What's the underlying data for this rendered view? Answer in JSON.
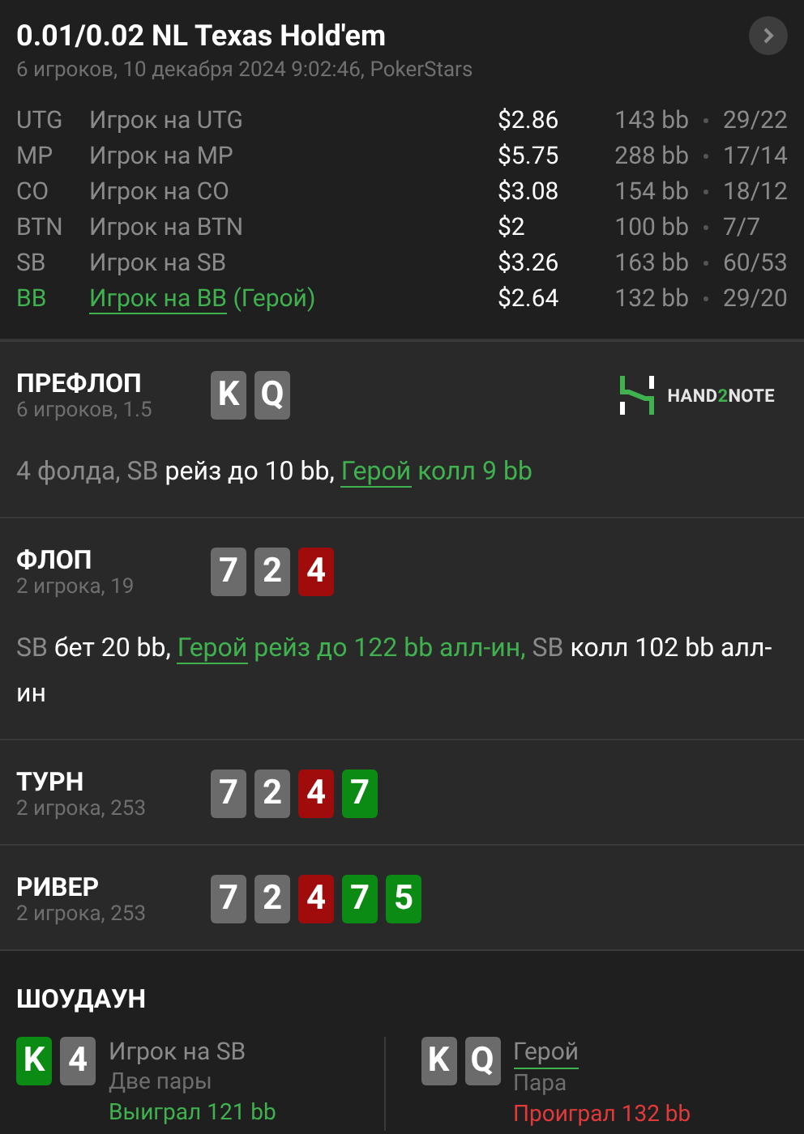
{
  "header": {
    "title": "0.01/0.02 NL Texas Hold'em",
    "subtitle": "6 игроков, 10 декабря 2024 9:02:46, PokerStars"
  },
  "players": [
    {
      "position": "UTG",
      "name": "Игрок на UTG",
      "hero": false,
      "stack": "$2.86",
      "bb": "143 bb",
      "stats": "29/22"
    },
    {
      "position": "MP",
      "name": "Игрок на MP",
      "hero": false,
      "stack": "$5.75",
      "bb": "288 bb",
      "stats": "17/14"
    },
    {
      "position": "CO",
      "name": "Игрок на CO",
      "hero": false,
      "stack": "$3.08",
      "bb": "154 bb",
      "stats": "18/12"
    },
    {
      "position": "BTN",
      "name": "Игрок на BTN",
      "hero": false,
      "stack": "$2",
      "bb": "100 bb",
      "stats": "7/7"
    },
    {
      "position": "SB",
      "name": "Игрок на SB",
      "hero": false,
      "stack": "$3.26",
      "bb": "163 bb",
      "stats": "60/53"
    },
    {
      "position": "BB",
      "name": "Игрок на BB",
      "hero_label": "(Герой)",
      "hero": true,
      "stack": "$2.64",
      "bb": "132 bb",
      "stats": "29/20"
    }
  ],
  "logo": {
    "start": "HAND",
    "mid": "2",
    "end": "NOTE"
  },
  "streets": [
    {
      "name": "ПРЕФЛОП",
      "info": "6 игроков, 1.5",
      "cards": [
        {
          "rank": "K",
          "color": "#6b6b6b"
        },
        {
          "rank": "Q",
          "color": "#6b6b6b"
        }
      ],
      "actions": [
        {
          "kind": "player",
          "text": "4 фолда, SB"
        },
        {
          "kind": "action",
          "text": "рейз до 10 bb,"
        },
        {
          "kind": "hero",
          "text": "Герой"
        },
        {
          "kind": "hero_action",
          "text": "колл 9 bb"
        }
      ]
    },
    {
      "name": "ФЛОП",
      "info": "2 игрока, 19",
      "cards": [
        {
          "rank": "7",
          "color": "#6b6b6b"
        },
        {
          "rank": "2",
          "color": "#6b6b6b"
        },
        {
          "rank": "4",
          "color": "#a00c0c"
        }
      ],
      "actions": [
        {
          "kind": "player",
          "text": "SB"
        },
        {
          "kind": "action",
          "text": "бет 20 bb,"
        },
        {
          "kind": "hero",
          "text": "Герой"
        },
        {
          "kind": "hero_action",
          "text": "рейз до 122 bb алл-ин,"
        },
        {
          "kind": "player",
          "text": "SB"
        },
        {
          "kind": "action",
          "text": "колл 102 bb алл-ин"
        }
      ]
    },
    {
      "name": "ТУРН",
      "info": "2 игрока, 253",
      "cards": [
        {
          "rank": "7",
          "color": "#6b6b6b"
        },
        {
          "rank": "2",
          "color": "#6b6b6b"
        },
        {
          "rank": "4",
          "color": "#a00c0c"
        },
        {
          "rank": "7",
          "color": "#0b8a14"
        }
      ]
    },
    {
      "name": "РИВЕР",
      "info": "2 игрока, 253",
      "cards": [
        {
          "rank": "7",
          "color": "#6b6b6b"
        },
        {
          "rank": "2",
          "color": "#6b6b6b"
        },
        {
          "rank": "4",
          "color": "#a00c0c"
        },
        {
          "rank": "7",
          "color": "#0b8a14"
        },
        {
          "rank": "5",
          "color": "#0b8a14"
        }
      ]
    }
  ],
  "showdown": {
    "title": "ШОУДАУН",
    "hands": [
      {
        "cards": [
          {
            "rank": "K",
            "color": "#0b8a14"
          },
          {
            "rank": "4",
            "color": "#6b6b6b"
          }
        ],
        "player": "Игрок на SB",
        "hero": false,
        "hand": "Две пары",
        "result": "Выиграл 121 bb",
        "won": true
      },
      {
        "cards": [
          {
            "rank": "K",
            "color": "#6b6b6b"
          },
          {
            "rank": "Q",
            "color": "#6b6b6b"
          }
        ],
        "player": "Герой",
        "hero": true,
        "hand": "Пара",
        "result": "Проиграл 132 bb",
        "won": false
      }
    ]
  }
}
